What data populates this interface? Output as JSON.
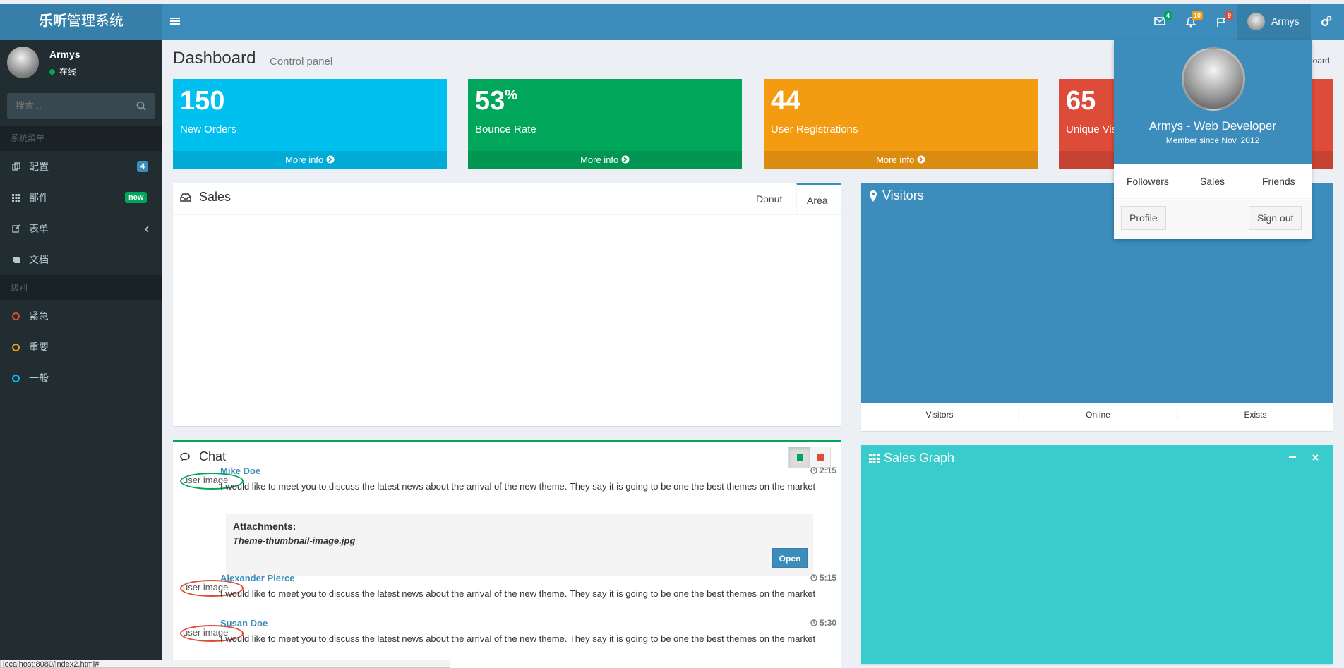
{
  "brand": {
    "bold": "乐听",
    "rest": "管理系统"
  },
  "topnav": {
    "mail_count": "4",
    "bell_count": "10",
    "flag_count": "9",
    "username": "Armys",
    "colors": {
      "mail": "#00a65a",
      "bell": "#f39c12",
      "flag": "#dd4b39"
    }
  },
  "sidebar": {
    "user_name": "Armys",
    "status": "在线",
    "search_placeholder": "搜索...",
    "section_main": "系统菜单",
    "items": [
      {
        "label": "配置",
        "icon": "copy-icon",
        "badge": "4"
      },
      {
        "label": "部件",
        "icon": "grid-icon",
        "badge": "new"
      },
      {
        "label": "表单",
        "icon": "edit-icon"
      },
      {
        "label": "文档",
        "icon": "book-icon"
      }
    ],
    "section_levels": "级别",
    "levels": [
      {
        "label": "紧急",
        "color": "#dd4b39"
      },
      {
        "label": "重要",
        "color": "#f39c12"
      },
      {
        "label": "一般",
        "color": "#00c0ef"
      }
    ]
  },
  "header": {
    "title": "Dashboard",
    "subtitle": "Control panel",
    "breadcrumb_tail": "board"
  },
  "stats": [
    {
      "value": "150",
      "suffix": "",
      "label": "New Orders",
      "more": "More info",
      "color": "#00c0ef"
    },
    {
      "value": "53",
      "suffix": "%",
      "label": "Bounce Rate",
      "more": "More info",
      "color": "#00a65a"
    },
    {
      "value": "44",
      "suffix": "",
      "label": "User Registrations",
      "more": "More info",
      "color": "#f39c12"
    },
    {
      "value": "65",
      "suffix": "",
      "label": "Unique Vis",
      "more": "",
      "color": "#dd4b39"
    }
  ],
  "sales": {
    "title": "Sales",
    "tab_donut": "Donut",
    "tab_area": "Area"
  },
  "visitors": {
    "title": "Visitors",
    "col1": "Visitors",
    "col2": "Online",
    "col3": "Exists"
  },
  "chat": {
    "title": "Chat",
    "alt": "user image",
    "messages": [
      {
        "name": "Mike Doe",
        "time": "2:15",
        "text": "I would like to meet you to discuss the latest news about the arrival of the new theme. They say it is going to be one the best themes on the market",
        "ring": "#00a65a"
      },
      {
        "name": "Alexander Pierce",
        "time": "5:15",
        "text": "I would like to meet you to discuss the latest news about the arrival of the new theme. They say it is going to be one the best themes on the market",
        "ring": "#dd4b39"
      },
      {
        "name": "Susan Doe",
        "time": "5:30",
        "text": "I would like to meet you to discuss the latest news about the arrival of the new theme. They say it is going to be one the best themes on the market",
        "ring": "#dd4b39"
      }
    ],
    "attachment_heading": "Attachments:",
    "attachment_file": "Theme-thumbnail-image.jpg",
    "open_label": "Open"
  },
  "sales_graph": {
    "title": "Sales Graph"
  },
  "user_dropdown": {
    "name": "Armys - Web Developer",
    "member_since": "Member since Nov. 2012",
    "links": [
      "Followers",
      "Sales",
      "Friends"
    ],
    "profile": "Profile",
    "signout": "Sign out"
  },
  "status_url": "localhost:8080/index2.html#"
}
